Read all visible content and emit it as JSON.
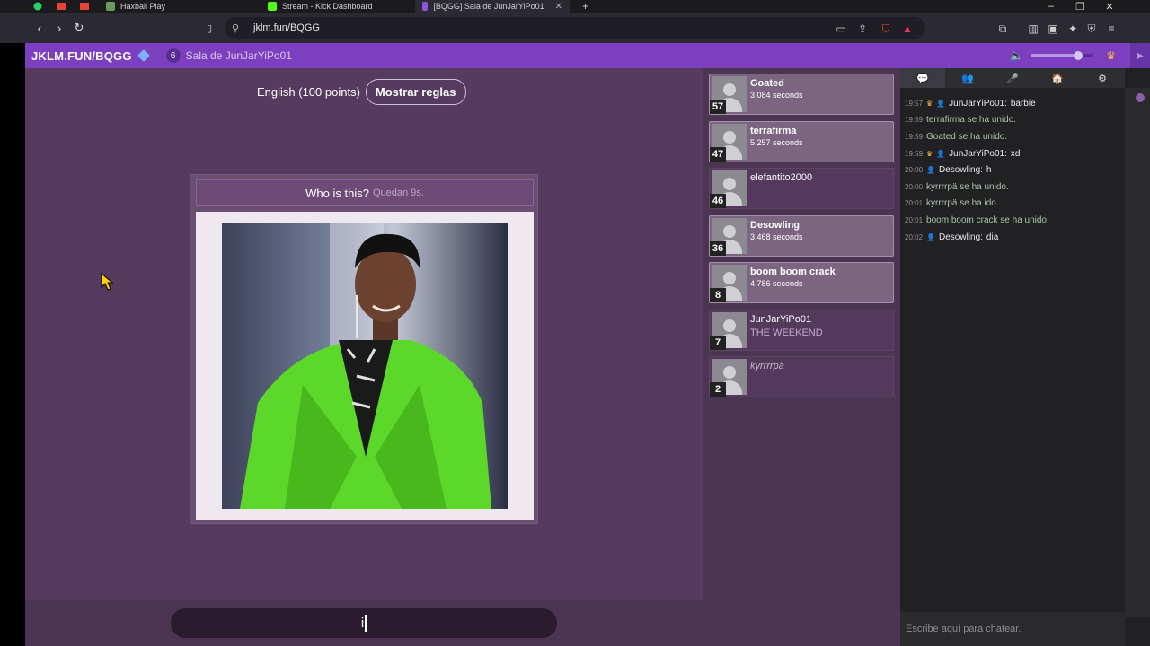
{
  "browser": {
    "tabs": [
      {
        "label": "Haxball Play",
        "color": "#6b9b5c"
      },
      {
        "label": "Stream - Kick Dashboard",
        "color": "#53fc18"
      },
      {
        "label": "[BQGG] Sala de JunJarYiPo01",
        "color": "#8b55d8"
      }
    ],
    "url": "jklm.fun/BQGG"
  },
  "site": {
    "title": "JKLM.FUN/BQGG",
    "player_count": "6",
    "room_name": "Sala de JunJarYiPo01",
    "volume": 0.75
  },
  "game": {
    "language_label": "English (100 points)",
    "rules_button": "Mostrar reglas",
    "question": "Who is this?",
    "time_left": "Quedan 9s.",
    "answer_value": "i"
  },
  "players": [
    {
      "name": "Goated",
      "info": "3.084 seconds",
      "score": "57",
      "state": "done"
    },
    {
      "name": "terrafirma",
      "info": "5.257 seconds",
      "score": "47",
      "state": "done"
    },
    {
      "name": "elefantito2000",
      "info": "",
      "score": "46",
      "state": "idle"
    },
    {
      "name": "Desowling",
      "info": "3.468 seconds",
      "score": "36",
      "state": "done"
    },
    {
      "name": "boom boom crack",
      "info": "4.786 seconds",
      "score": "8",
      "state": "done"
    },
    {
      "name": "JunJarYiPo01",
      "info": "THE WEEKEND",
      "score": "7",
      "state": "idle-guess"
    },
    {
      "name": "kyrrrrpä",
      "info": "",
      "score": "2",
      "state": "away"
    }
  ],
  "chat": {
    "tabs": [
      "chat-icon",
      "players-icon",
      "mic-icon",
      "room-icon",
      "gear-icon"
    ],
    "messages": [
      {
        "ts": "19:57",
        "user": "JunJarYiPo01",
        "text": "barbie",
        "crown": true
      },
      {
        "ts": "19:59",
        "system": "terrafirma se ha unido."
      },
      {
        "ts": "19:59",
        "system": "Goated se ha unido."
      },
      {
        "ts": "19:59",
        "user": "JunJarYiPo01",
        "text": "xd",
        "crown": true
      },
      {
        "ts": "20:00",
        "user": "Desowling",
        "text": "h",
        "crown": false
      },
      {
        "ts": "20:00",
        "system": "kyrrrrpä se ha unido."
      },
      {
        "ts": "20:01",
        "system": "kyrrrrpä se ha ido."
      },
      {
        "ts": "20:01",
        "system": "boom boom crack se ha unido."
      },
      {
        "ts": "20:02",
        "user": "Desowling",
        "text": "dia",
        "crown": false
      }
    ],
    "input_placeholder": "Escribe aquí para chatear."
  }
}
